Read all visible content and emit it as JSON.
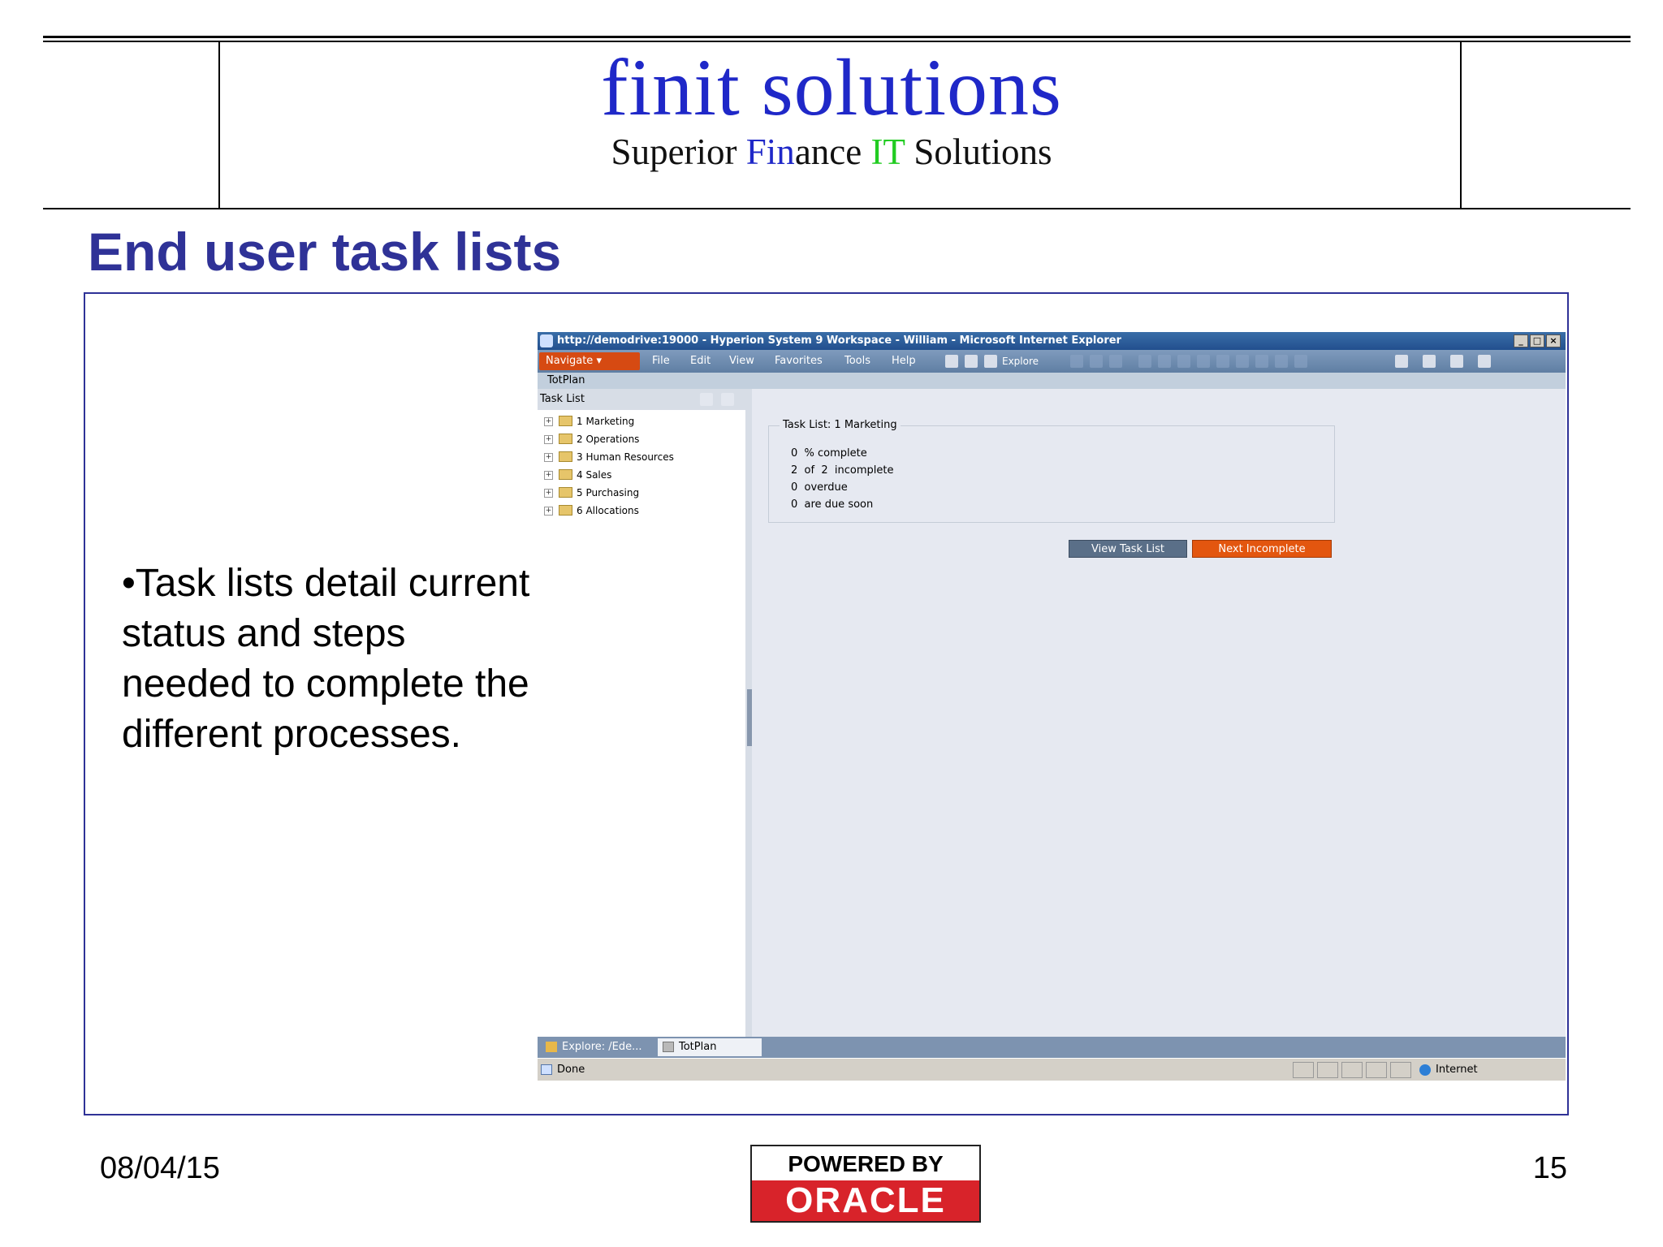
{
  "logo": {
    "word1": "finit",
    "word2": "solutions",
    "tagline": {
      "p1": "Superior ",
      "p2": "Fin",
      "p3": "ance ",
      "p4": "IT",
      "p5": " Solutions"
    }
  },
  "slide": {
    "title": "End user task lists",
    "bullet": "•Task lists detail current status and steps needed to complete the different processes."
  },
  "footer": {
    "date": "08/04/15",
    "page": "15",
    "powered_by": "POWERED BY",
    "oracle": "ORACLE"
  },
  "browser": {
    "title": "http://demodrive:19000 - Hyperion System 9 Workspace - William - Microsoft Internet Explorer",
    "window_buttons": [
      "_",
      "□",
      "×"
    ],
    "navigate": "Navigate ▾",
    "menus": [
      "File",
      "Edit",
      "View",
      "Favorites",
      "Tools",
      "Help"
    ],
    "explore": "Explore",
    "doc_tab": "TotPlan"
  },
  "task_list": {
    "header": "Task List",
    "items": [
      "1 Marketing",
      "2 Operations",
      "3 Human Resources",
      "4 Sales",
      "5 Purchasing",
      "6 Allocations"
    ]
  },
  "summary": {
    "title": "Task List: 1 Marketing",
    "lines": [
      "0  % complete",
      "2  of  2  incomplete",
      "0  overdue",
      "0  are due soon"
    ]
  },
  "buttons": {
    "view": "View Task List",
    "next": "Next Incomplete"
  },
  "taskbar": {
    "tabs": [
      "Explore: /Ede...",
      "TotPlan"
    ]
  },
  "status": {
    "text": "Done",
    "zone": "Internet"
  },
  "colors": {
    "title_blue": "#2f3297",
    "logo_blue": "#1f28c8",
    "logo_green": "#22cc22",
    "oracle_red": "#d8232a",
    "next_orange": "#e3560f"
  }
}
